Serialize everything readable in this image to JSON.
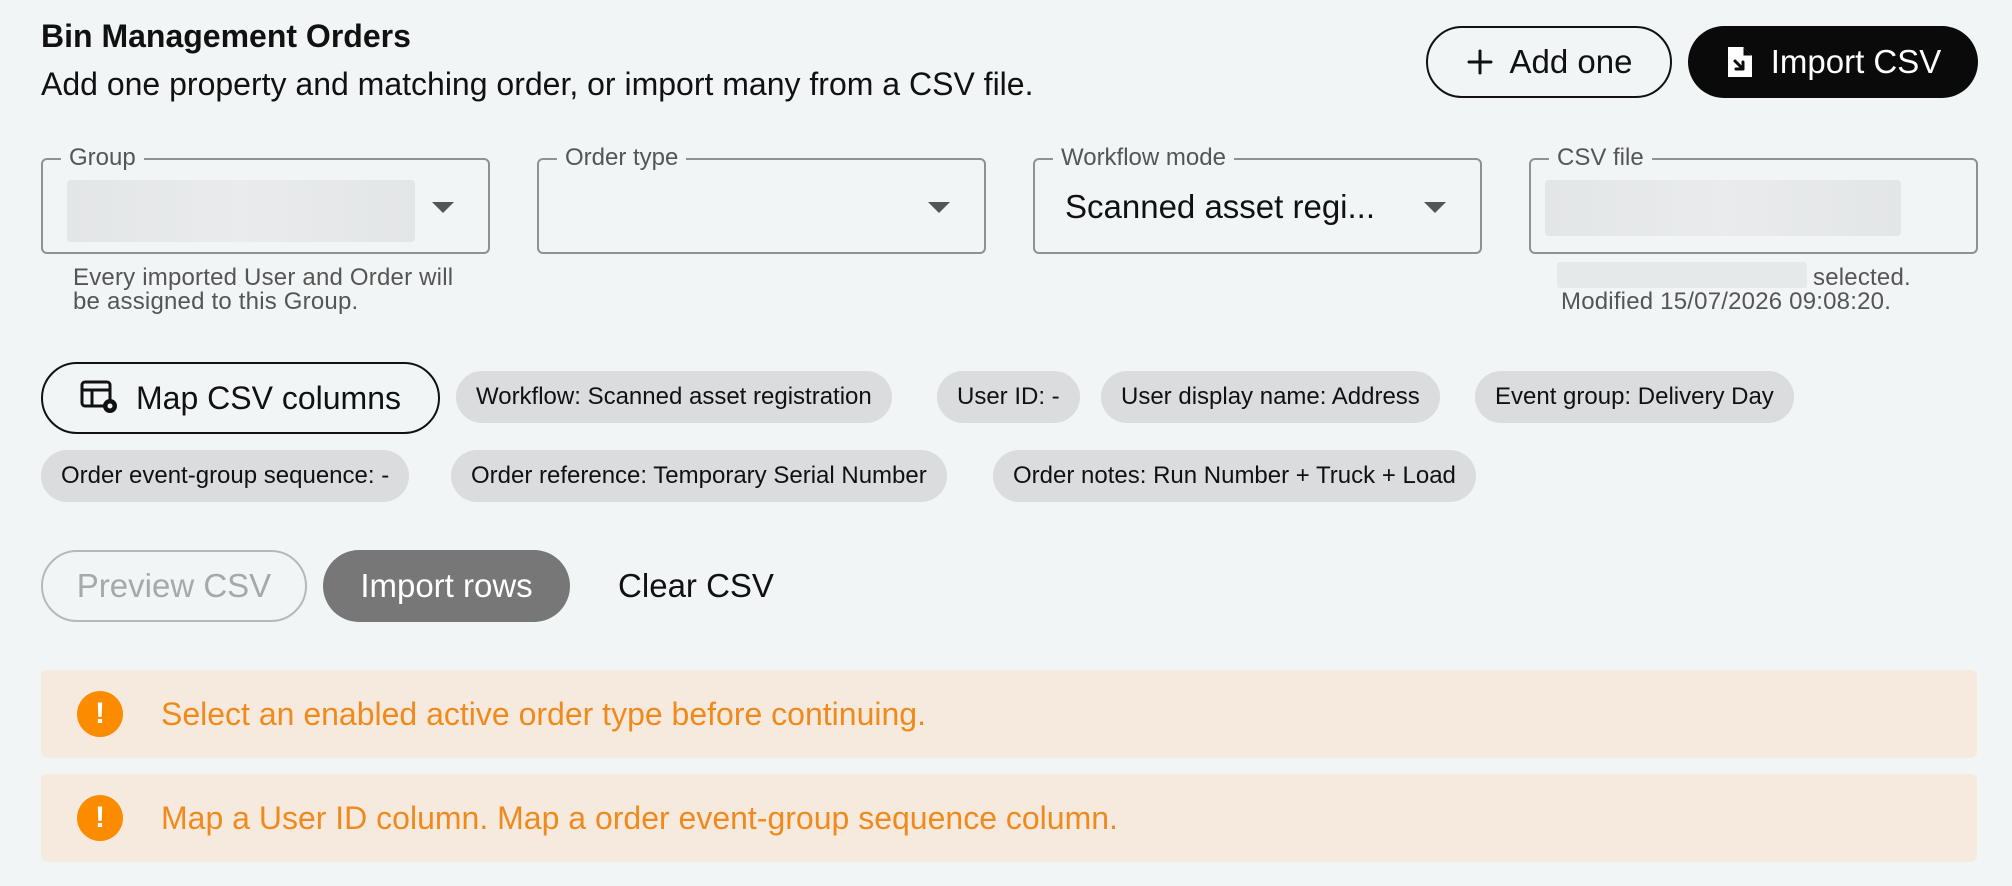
{
  "header": {
    "title": "Bin Management Orders",
    "subtitle": "Add one property and matching order, or import many from a CSV file."
  },
  "actions": {
    "add_one": "Add one",
    "import_csv": "Import CSV"
  },
  "fields": {
    "group": {
      "label": "Group",
      "value": "",
      "helper": "Every imported User and Order will be assigned to this Group."
    },
    "order_type": {
      "label": "Order type",
      "value": ""
    },
    "workflow_mode": {
      "label": "Workflow mode",
      "value": "Scanned asset regi..."
    },
    "csv_file": {
      "label": "CSV file",
      "value": "",
      "helper_selected": "selected.",
      "helper_modified": "Modified 15/07/2026 09:08:20."
    }
  },
  "mapping": {
    "map_button": "Map CSV columns",
    "chips": [
      "Workflow: Scanned asset registration",
      "User ID: -",
      "User display name: Address",
      "Event group: Delivery Day",
      "Order event-group sequence: -",
      "Order reference: Temporary Serial Number",
      "Order notes: Run Number + Truck + Load"
    ]
  },
  "controls": {
    "preview": "Preview CSV",
    "import_rows": "Import rows",
    "clear": "Clear CSV"
  },
  "alerts": [
    {
      "icon": "!",
      "text": "Select an enabled active order type before continuing."
    },
    {
      "icon": "!",
      "text": "Map a User ID column. Map a order event-group sequence column."
    }
  ],
  "colors": {
    "background": "#f2f5f6",
    "primary_dark": "#0a0a0a",
    "chip": "#dadcdd",
    "warning": "#fb8c00",
    "warning_bg": "#f6eadf"
  }
}
